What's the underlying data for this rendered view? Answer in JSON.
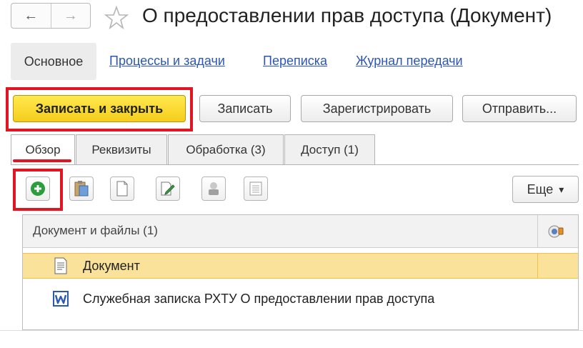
{
  "window": {
    "title": "О предоставлении прав доступа (Документ)"
  },
  "nav": {
    "back_icon": "←",
    "forward_icon": "→"
  },
  "sections": {
    "active": "Основное",
    "links": [
      "Процессы и задачи",
      "Переписка",
      "Журнал передачи"
    ]
  },
  "commands": {
    "save_close": "Записать и закрыть",
    "save": "Записать",
    "register": "Зарегистрировать",
    "send": "Отправить..."
  },
  "tabs": [
    "Обзор",
    "Реквизиты",
    "Обработка (3)",
    "Доступ (1)"
  ],
  "toolbar": {
    "more_label": "Еще",
    "more_arrow": "▾"
  },
  "files_table": {
    "header": "Документ и файлы (1)",
    "rows": [
      {
        "label": "Документ",
        "icon": "document-icon",
        "selected": true
      },
      {
        "label": "Служебная записка РХТУ О предоставлении прав доступа",
        "icon": "word-icon",
        "selected": false
      }
    ]
  },
  "colors": {
    "accent": "#f5cd1c",
    "highlight": "#e01622",
    "link": "#2b56b8",
    "selection": "#fae29a"
  }
}
